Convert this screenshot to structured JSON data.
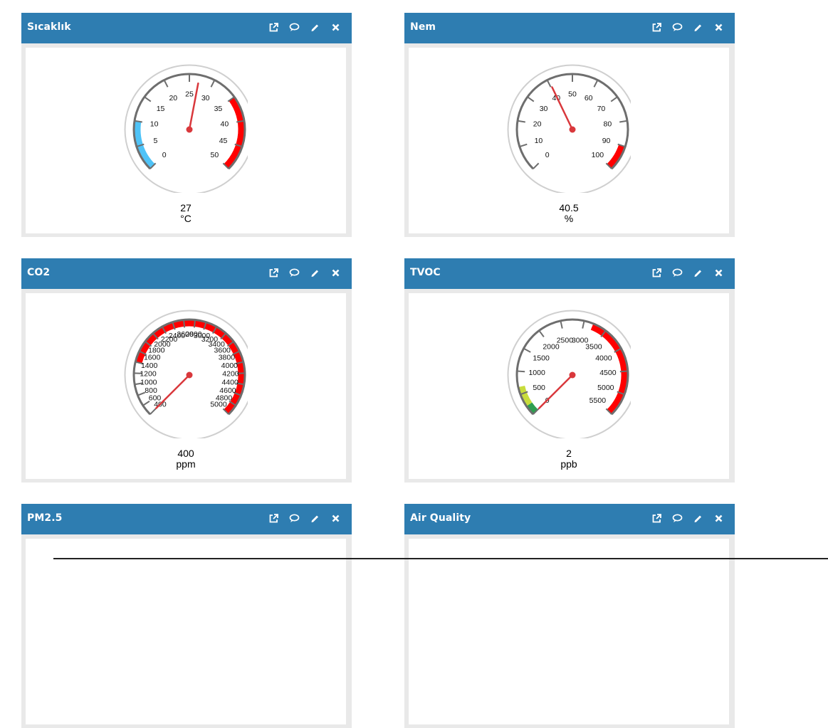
{
  "widgets": [
    {
      "title": "Sıcaklık",
      "value": "27",
      "unit": "°C",
      "min": 0,
      "max": 50,
      "current": 27,
      "ticks": [
        "0",
        "5",
        "10",
        "15",
        "20",
        "25",
        "30",
        "35",
        "40",
        "45",
        "50"
      ],
      "bands": [
        {
          "from": 0,
          "to": 10,
          "color": "#4fc3f7"
        },
        {
          "from": 35,
          "to": 50,
          "color": "#ff0000"
        }
      ]
    },
    {
      "title": "Nem",
      "value": "40.5",
      "unit": "%",
      "min": 0,
      "max": 100,
      "current": 40.5,
      "ticks": [
        "0",
        "10",
        "20",
        "30",
        "40",
        "50",
        "60",
        "70",
        "80",
        "90",
        "100"
      ],
      "bands": [
        {
          "from": 90,
          "to": 100,
          "color": "#ff0000"
        }
      ]
    },
    {
      "title": "CO2",
      "value": "400",
      "unit": "ppm",
      "min": 400,
      "max": 5000,
      "current": 400,
      "ticks": [
        "400",
        "600",
        "800",
        "1000",
        "1200",
        "1400",
        "1600",
        "1800",
        "2000",
        "2200",
        "2400",
        "2600",
        "2800",
        "3000",
        "3200",
        "3400",
        "3600",
        "3800",
        "4000",
        "4200",
        "4400",
        "4600",
        "4800",
        "5000"
      ],
      "bands": [
        {
          "from": 1400,
          "to": 5000,
          "color": "#ff0000"
        }
      ]
    },
    {
      "title": "TVOC",
      "value": "2",
      "unit": "ppb",
      "min": 0,
      "max": 5500,
      "current": 2,
      "ticks": [
        "0",
        "500",
        "1000",
        "1500",
        "2000",
        "2500",
        "3000",
        "3500",
        "4000",
        "4500",
        "5000",
        "5500"
      ],
      "bands": [
        {
          "from": 0,
          "to": 220,
          "color": "#2e9e4f"
        },
        {
          "from": 220,
          "to": 660,
          "color": "#c8dc3c"
        },
        {
          "from": 3200,
          "to": 5500,
          "color": "#ff0000"
        }
      ]
    },
    {
      "title": "PM2.5"
    },
    {
      "title": "Air Quality"
    }
  ],
  "actions": [
    "external-link-icon",
    "comment-icon",
    "edit-icon",
    "close-icon"
  ]
}
